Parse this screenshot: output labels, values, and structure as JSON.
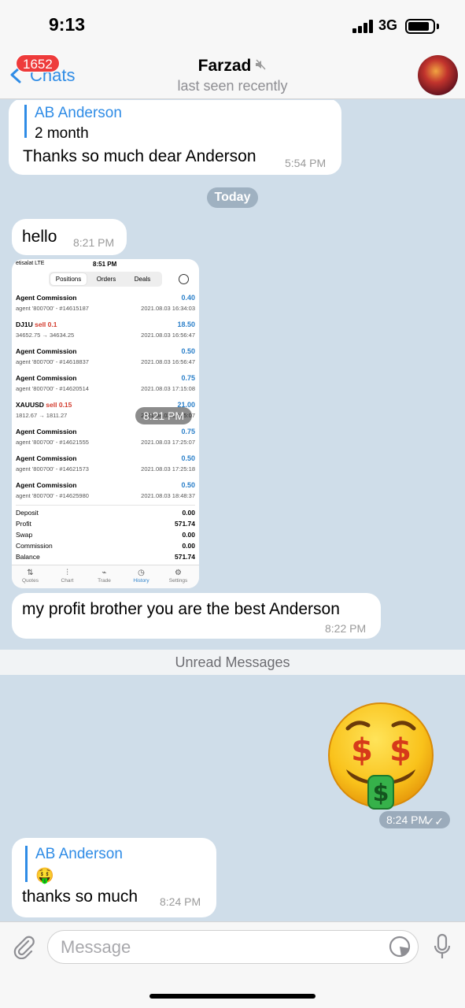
{
  "status_bar": {
    "time": "9:13",
    "network": "3G"
  },
  "header": {
    "back_label": "Chats",
    "unread_count": "1652",
    "title": "Farzad",
    "subtitle": "last seen recently"
  },
  "messages": {
    "m1": {
      "reply_name": "AB Anderson",
      "reply_text": "2 month",
      "text": "Thanks so much dear Anderson",
      "time": "5:54 PM"
    },
    "date_separator": "Today",
    "m2": {
      "text": "hello",
      "time": "8:21 PM"
    },
    "m3": {
      "time": "8:21 PM"
    },
    "m4": {
      "text": "my profit brother you are the best Anderson",
      "time": "8:22 PM"
    },
    "unread_separator": "Unread Messages",
    "m5": {
      "time": "8:24 PM"
    },
    "m6": {
      "reply_name": "AB Anderson",
      "reply_text": "🤑",
      "text": "thanks so much",
      "time": "8:24 PM"
    }
  },
  "trade_screenshot": {
    "carrier": "etisalat  LTE",
    "time": "8:51 PM",
    "tabs": [
      "Positions",
      "Orders",
      "Deals"
    ],
    "active_tab": "Positions",
    "rows": [
      {
        "name": "Agent Commission",
        "side": "",
        "sub": "agent '800700' - #14615187",
        "amount": "0.40",
        "date": "2021.08.03 16:34:03"
      },
      {
        "name": "DJ1U",
        "side": "sell 0.1",
        "sub": "34652.75 → 34634.25",
        "amount": "18.50",
        "date": "2021.08.03 16:56:47"
      },
      {
        "name": "Agent Commission",
        "side": "",
        "sub": "agent '800700' - #14618837",
        "amount": "0.50",
        "date": "2021.08.03 16:56:47"
      },
      {
        "name": "Agent Commission",
        "side": "",
        "sub": "agent '800700' - #14620514",
        "amount": "0.75",
        "date": "2021.08.03 17:15:08"
      },
      {
        "name": "XAUUSD",
        "side": "sell 0.15",
        "sub": "1812.67 → 1811.27",
        "amount": "21.00",
        "date": "2021.08.03 17:25:07"
      },
      {
        "name": "Agent Commission",
        "side": "",
        "sub": "agent '800700' - #14621555",
        "amount": "0.75",
        "date": "2021.08.03 17:25:07"
      },
      {
        "name": "Agent Commission",
        "side": "",
        "sub": "agent '800700' - #14621573",
        "amount": "0.50",
        "date": "2021.08.03 17:25:18"
      },
      {
        "name": "Agent Commission",
        "side": "",
        "sub": "agent '800700' - #14625980",
        "amount": "0.50",
        "date": "2021.08.03 18:48:37"
      }
    ],
    "summary": [
      {
        "label": "Deposit",
        "value": "0.00"
      },
      {
        "label": "Profit",
        "value": "571.74"
      },
      {
        "label": "Swap",
        "value": "0.00"
      },
      {
        "label": "Commission",
        "value": "0.00"
      },
      {
        "label": "Balance",
        "value": "571.74"
      }
    ],
    "bottom_tabs": [
      "Quotes",
      "Chart",
      "Trade",
      "History",
      "Settings"
    ],
    "active_bottom_tab": "History"
  },
  "input": {
    "placeholder": "Message"
  },
  "colors": {
    "accent": "#2f8ce6",
    "badge": "#ee3b3b",
    "chat_bg": "#cfdde9",
    "sell": "#d33a2c"
  },
  "icons": [
    "back-chevron-icon",
    "mute-icon",
    "attach-icon",
    "sticker-icon",
    "mic-icon",
    "read-checks-icon",
    "money-face-sticker"
  ]
}
